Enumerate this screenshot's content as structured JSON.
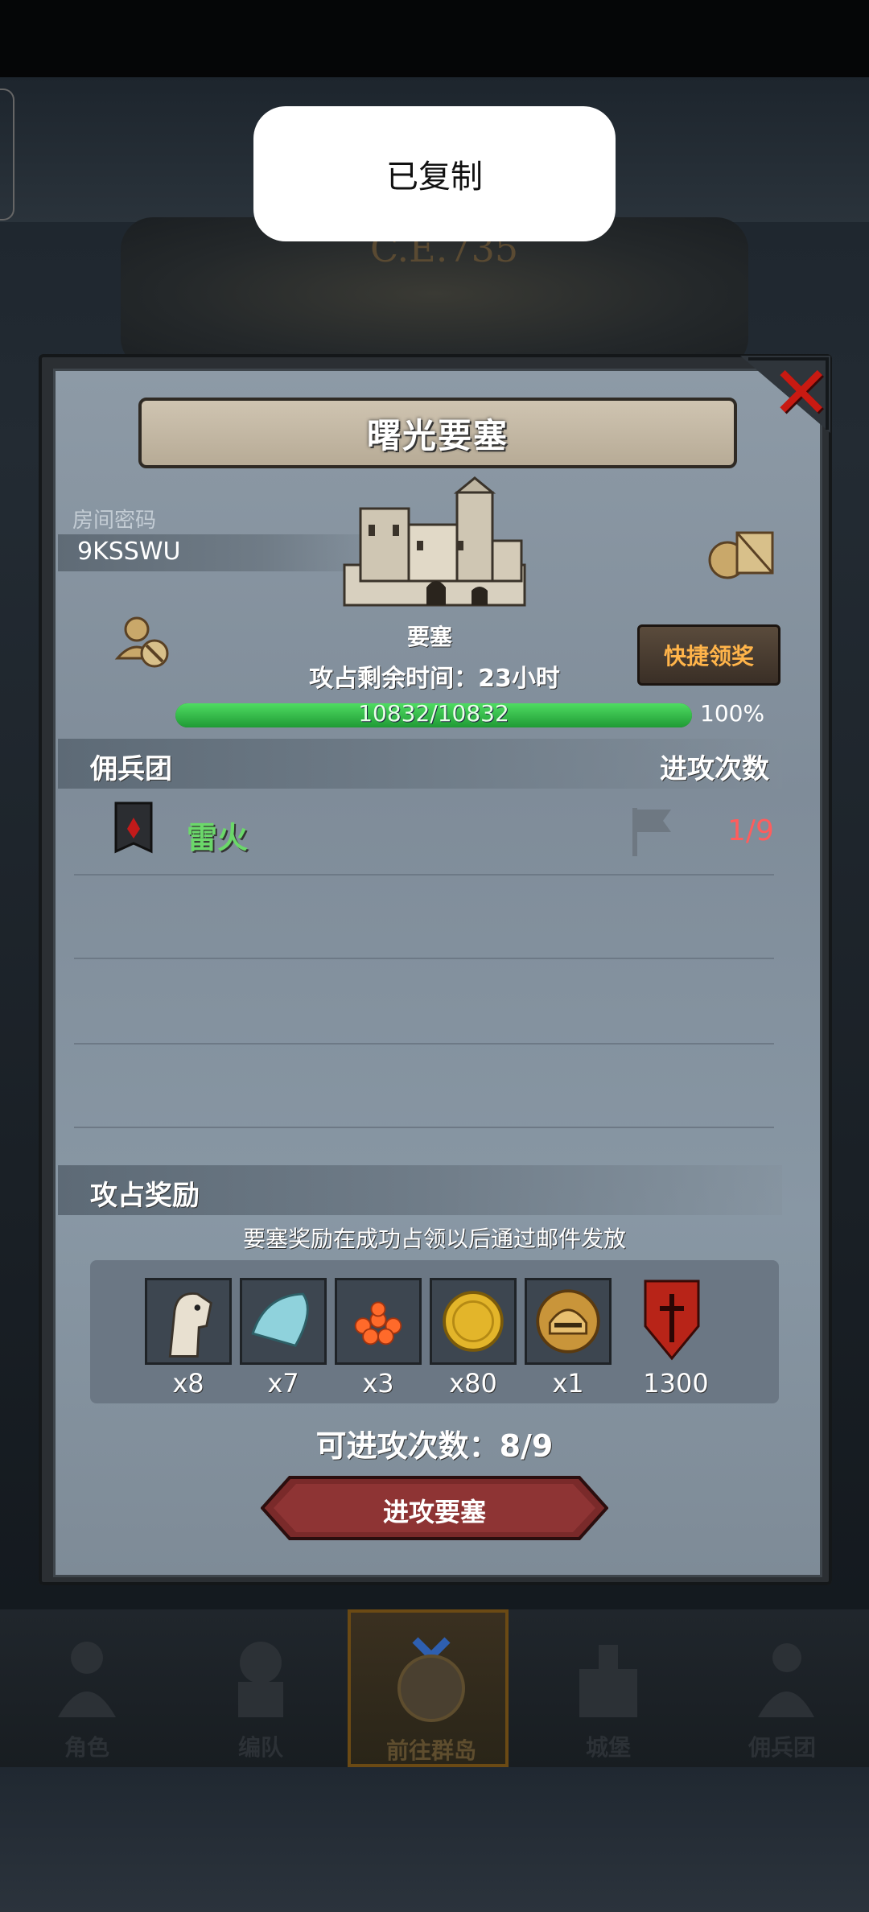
{
  "toast": {
    "text": "已复制"
  },
  "background": {
    "era_text": "C.E.735"
  },
  "dialog": {
    "title": "曙光要塞",
    "room_label": "房间密码",
    "room_code": "9KSSWU",
    "building_label": "要塞",
    "quick_claim_label": "快捷领奖",
    "time_remaining": "攻占剩余时间：23小时",
    "progress": {
      "text": "10832/10832",
      "percent_label": "100%",
      "fraction": 1.0
    },
    "mercenary_header": "佣兵团",
    "attacks_header": "进攻次数",
    "rows": [
      {
        "name": "雷火",
        "count": "1/9"
      }
    ],
    "reward_header": "攻占奖励",
    "reward_note": "要塞奖励在成功占领以后通过邮件发放",
    "rewards": [
      {
        "icon": "horse-icon",
        "qty": "x8"
      },
      {
        "icon": "cloth-icon",
        "qty": "x7"
      },
      {
        "icon": "roe-icon",
        "qty": "x3"
      },
      {
        "icon": "gold-coin-icon",
        "qty": "x80"
      },
      {
        "icon": "helmet-icon",
        "qty": "x1"
      },
      {
        "icon": "shield-emblem-icon",
        "qty": "1300"
      }
    ],
    "attack_available": "可进攻次数：8/9",
    "attack_button": "进攻要塞"
  },
  "nav": [
    {
      "label": "角色",
      "icon": "character-icon"
    },
    {
      "label": "编队",
      "icon": "formation-icon"
    },
    {
      "label": "前往群岛",
      "icon": "islands-globe-icon"
    },
    {
      "label": "城堡",
      "icon": "castle-icon"
    },
    {
      "label": "佣兵团",
      "icon": "mercenary-icon"
    }
  ],
  "colors": {
    "accent_green": "#6bd86a",
    "count_red": "#ff5d5d",
    "quick_orange": "#ffb44a",
    "close_red": "#c81a12"
  }
}
